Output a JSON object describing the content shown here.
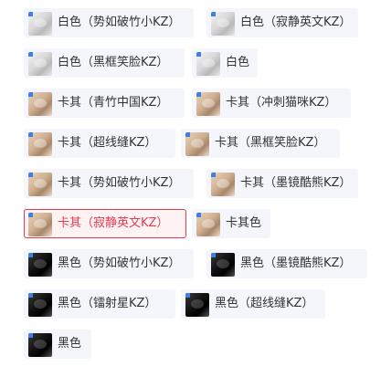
{
  "accent": "#e23c4f",
  "options": [
    {
      "label": "白色（势如破竹小KZ）",
      "color": "white",
      "selected": false
    },
    {
      "label": "白色（寂静英文KZ）",
      "color": "white",
      "selected": false
    },
    {
      "label": "白色（黑框笑脸KZ）",
      "color": "white",
      "selected": false
    },
    {
      "label": "白色",
      "color": "white",
      "selected": false
    },
    {
      "label": "卡其（青竹中国KZ）",
      "color": "khaki",
      "selected": false
    },
    {
      "label": "卡其（冲刺猫咪KZ）",
      "color": "khaki",
      "selected": false
    },
    {
      "label": "卡其（超线缝KZ）",
      "color": "khaki",
      "selected": false
    },
    {
      "label": "卡其（黑框笑脸KZ）",
      "color": "khaki",
      "selected": false
    },
    {
      "label": "卡其（势如破竹小KZ）",
      "color": "khaki",
      "selected": false
    },
    {
      "label": "卡其（墨镜酷熊KZ）",
      "color": "khaki",
      "selected": false
    },
    {
      "label": "卡其（寂静英文KZ）",
      "color": "khaki",
      "selected": true
    },
    {
      "label": "卡其色",
      "color": "khaki",
      "selected": false
    },
    {
      "label": "黑色（势如破竹小KZ）",
      "color": "black",
      "selected": false
    },
    {
      "label": "黑色（墨镜酷熊KZ）",
      "color": "black",
      "selected": false
    },
    {
      "label": "黑色（镭射星KZ）",
      "color": "black",
      "selected": false
    },
    {
      "label": "黑色（超线缝KZ）",
      "color": "black",
      "selected": false
    },
    {
      "label": "黑色",
      "color": "black",
      "selected": false
    }
  ]
}
